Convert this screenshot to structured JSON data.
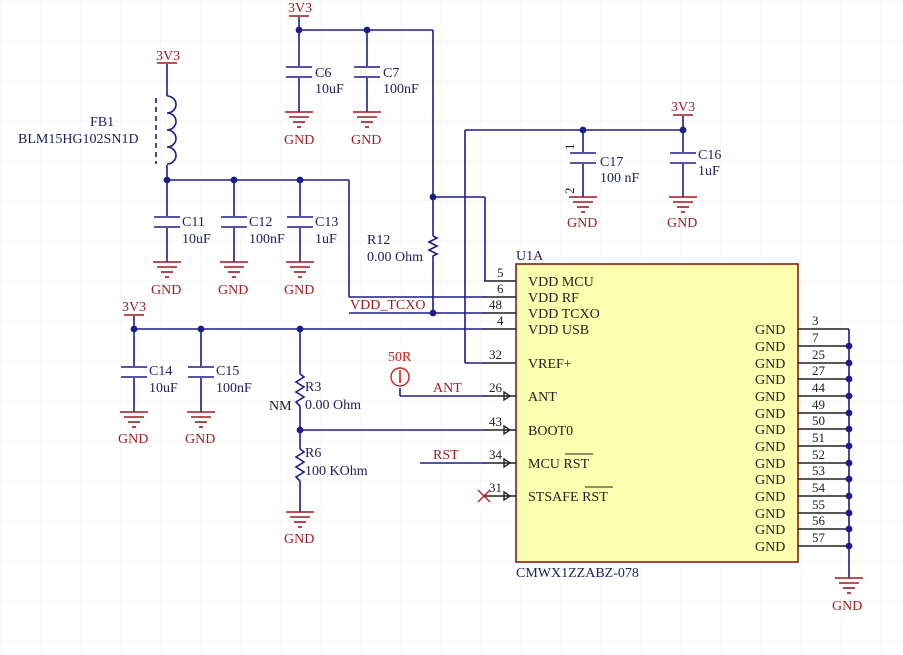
{
  "power": {
    "v3v3": "3V3",
    "gnd": "GND"
  },
  "components": {
    "fb1": {
      "designator": "FB1",
      "value": "BLM15HG102SN1D"
    },
    "c6": {
      "designator": "C6",
      "value": "10uF"
    },
    "c7": {
      "designator": "C7",
      "value": "100nF"
    },
    "c11": {
      "designator": "C11",
      "value": "10uF"
    },
    "c12": {
      "designator": "C12",
      "value": "100nF"
    },
    "c13": {
      "designator": "C13",
      "value": "1uF"
    },
    "c14": {
      "designator": "C14",
      "value": "10uF"
    },
    "c15": {
      "designator": "C15",
      "value": "100nF"
    },
    "c16": {
      "designator": "C16",
      "value": "1uF"
    },
    "c17": {
      "designator": "C17",
      "value": "100 nF"
    },
    "r12": {
      "designator": "R12",
      "value": "0.00 Ohm"
    },
    "r3": {
      "designator": "R3",
      "value": "0.00 Ohm",
      "note": "NM"
    },
    "r6": {
      "designator": "R6",
      "value": "100 KOhm"
    },
    "c17_pin1": "1",
    "c17_pin2": "2"
  },
  "test_point": {
    "label": "50R"
  },
  "nets": {
    "vdd_tcxo": "VDD_TCXO",
    "ant": "ANT",
    "rst": "RST"
  },
  "u1a": {
    "designator": "U1A",
    "part": "CMWX1ZZABZ-078",
    "left_pins": [
      {
        "num": "5",
        "name": "VDD MCU"
      },
      {
        "num": "6",
        "name": "VDD RF"
      },
      {
        "num": "48",
        "name": "VDD TCXO"
      },
      {
        "num": "4",
        "name": "VDD USB"
      },
      {
        "num": "32",
        "name": "VREF+"
      },
      {
        "num": "26",
        "name": "ANT"
      },
      {
        "num": "43",
        "name": "BOOT0"
      },
      {
        "num": "34",
        "name": "MCU RST"
      },
      {
        "num": "31",
        "name": "STSAFE RST"
      }
    ],
    "right_pins": [
      {
        "num": "3",
        "name": "GND"
      },
      {
        "num": "7",
        "name": "GND"
      },
      {
        "num": "25",
        "name": "GND"
      },
      {
        "num": "27",
        "name": "GND"
      },
      {
        "num": "44",
        "name": "GND"
      },
      {
        "num": "49",
        "name": "GND"
      },
      {
        "num": "50",
        "name": "GND"
      },
      {
        "num": "51",
        "name": "GND"
      },
      {
        "num": "52",
        "name": "GND"
      },
      {
        "num": "53",
        "name": "GND"
      },
      {
        "num": "54",
        "name": "GND"
      },
      {
        "num": "55",
        "name": "GND"
      },
      {
        "num": "56",
        "name": "GND"
      },
      {
        "num": "57",
        "name": "GND"
      }
    ]
  },
  "colors": {
    "wire": "#1c1c8c",
    "power": "#a1181e",
    "ic_fill": "#ffffb0",
    "ic_border": "#8b1a1a",
    "test_point": "#d41c1c"
  }
}
